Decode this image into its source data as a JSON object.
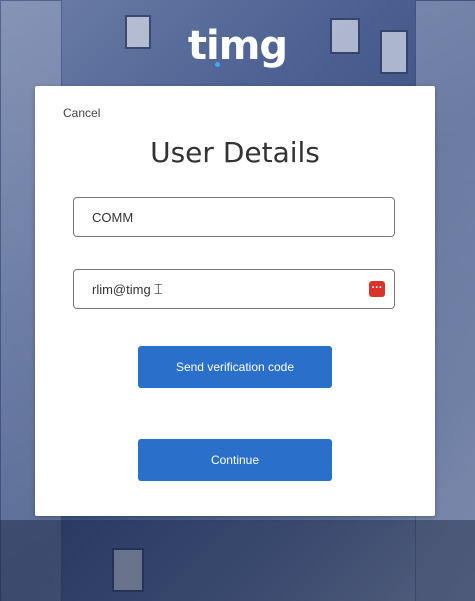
{
  "logo": {
    "text": "timg",
    "accent_color": "#3da8ff"
  },
  "card": {
    "cancel_label": "Cancel",
    "title": "User Details",
    "fields": {
      "name_value": "COMM",
      "email_value": "rlim@timg"
    },
    "buttons": {
      "verify_label": "Send verification code",
      "continue_label": "Continue"
    },
    "password_manager_icon": "password-manager-icon"
  },
  "colors": {
    "primary_button": "#2a6fca",
    "password_manager": "#d9342b",
    "background": "#4f6494"
  }
}
